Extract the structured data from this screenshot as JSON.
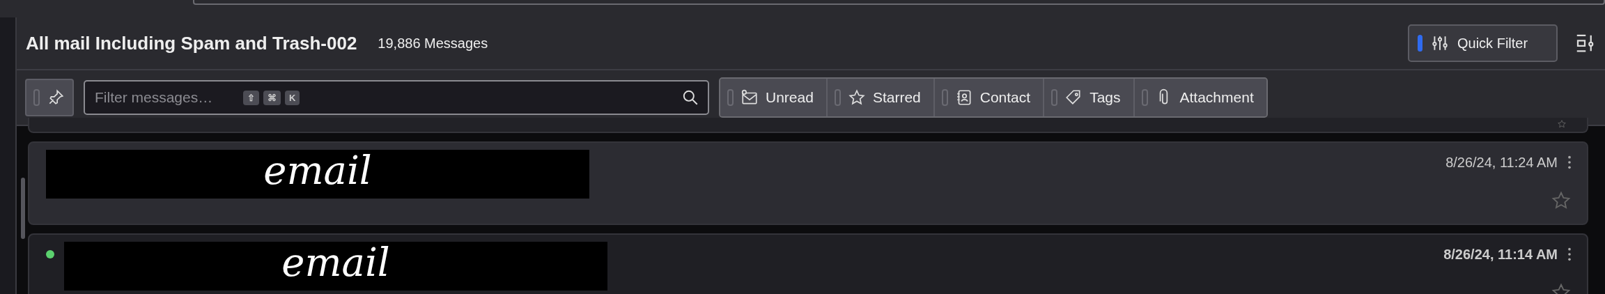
{
  "header": {
    "folder_title": "All mail Including Spam and Trash-002",
    "message_count": "19,886 Messages",
    "quick_filter": {
      "label": "Quick Filter",
      "on": true
    }
  },
  "filter_bar": {
    "pinned": false,
    "search": {
      "placeholder": "Filter messages…",
      "shortcut_keys": [
        "⇧",
        "⌘",
        "K"
      ]
    },
    "toggles": [
      {
        "kind": "unread",
        "label": "Unread",
        "selected": false
      },
      {
        "kind": "starred",
        "label": "Starred",
        "selected": false
      },
      {
        "kind": "contact",
        "label": "Contact",
        "selected": false
      },
      {
        "kind": "tags",
        "label": "Tags",
        "selected": false
      },
      {
        "kind": "attachment",
        "label": "Attachment",
        "selected": false
      }
    ]
  },
  "messages": [
    {
      "date": "8/26/24, 11:24 AM",
      "unread": false,
      "starred": false,
      "redaction_label": "email"
    },
    {
      "date": "8/26/24, 11:14 AM",
      "unread": true,
      "starred": false,
      "redaction_label": "email"
    }
  ]
}
